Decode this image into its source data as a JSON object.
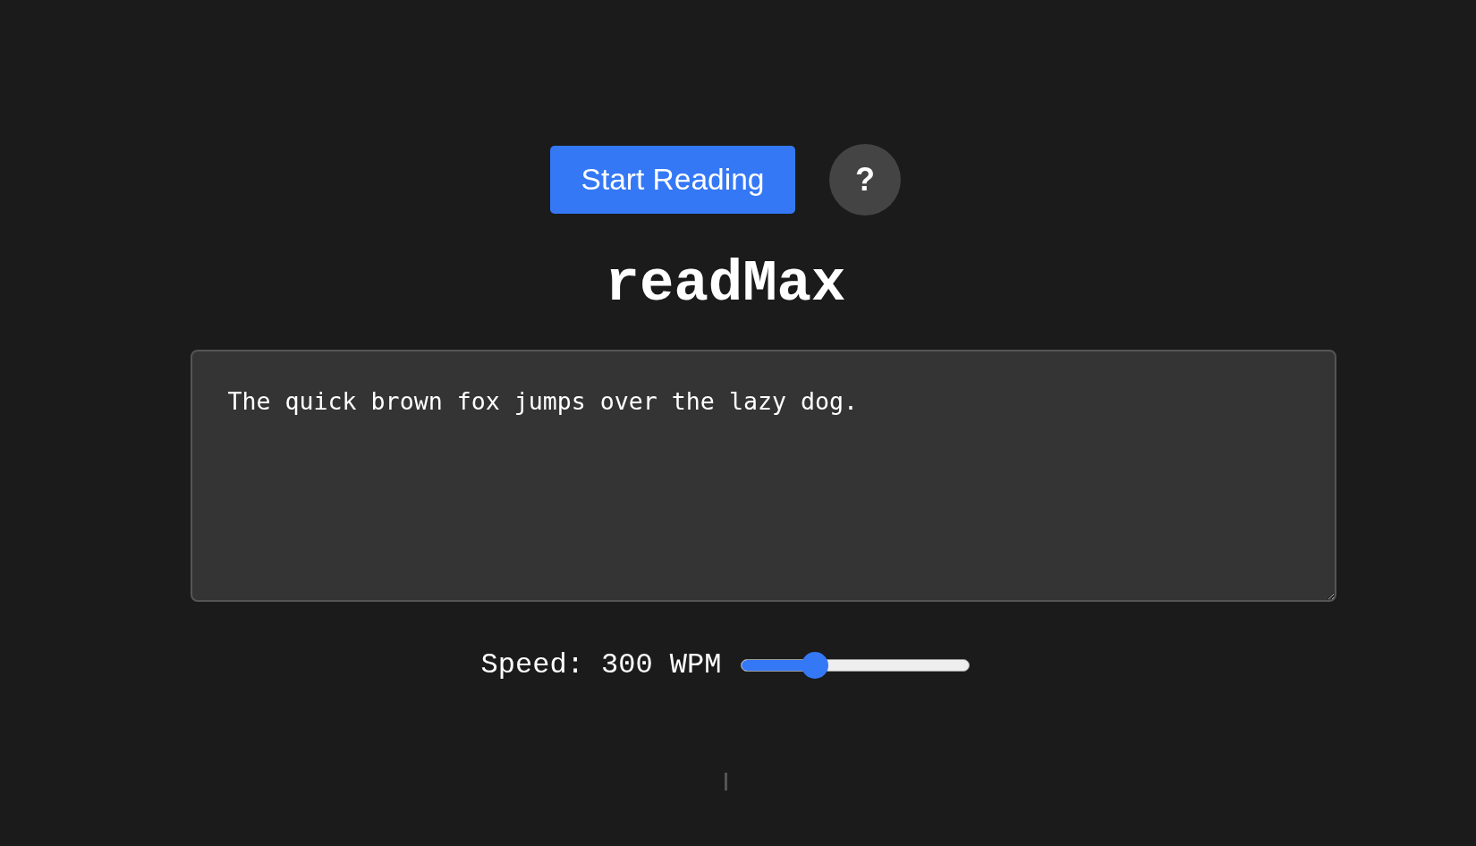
{
  "controls": {
    "start_button": "Start Reading",
    "help_button": "?"
  },
  "title": "readMax",
  "text_input": {
    "value": "The quick brown fox jumps over the lazy dog."
  },
  "speed": {
    "label": "Speed: 300 WPM",
    "level": 0.3
  }
}
